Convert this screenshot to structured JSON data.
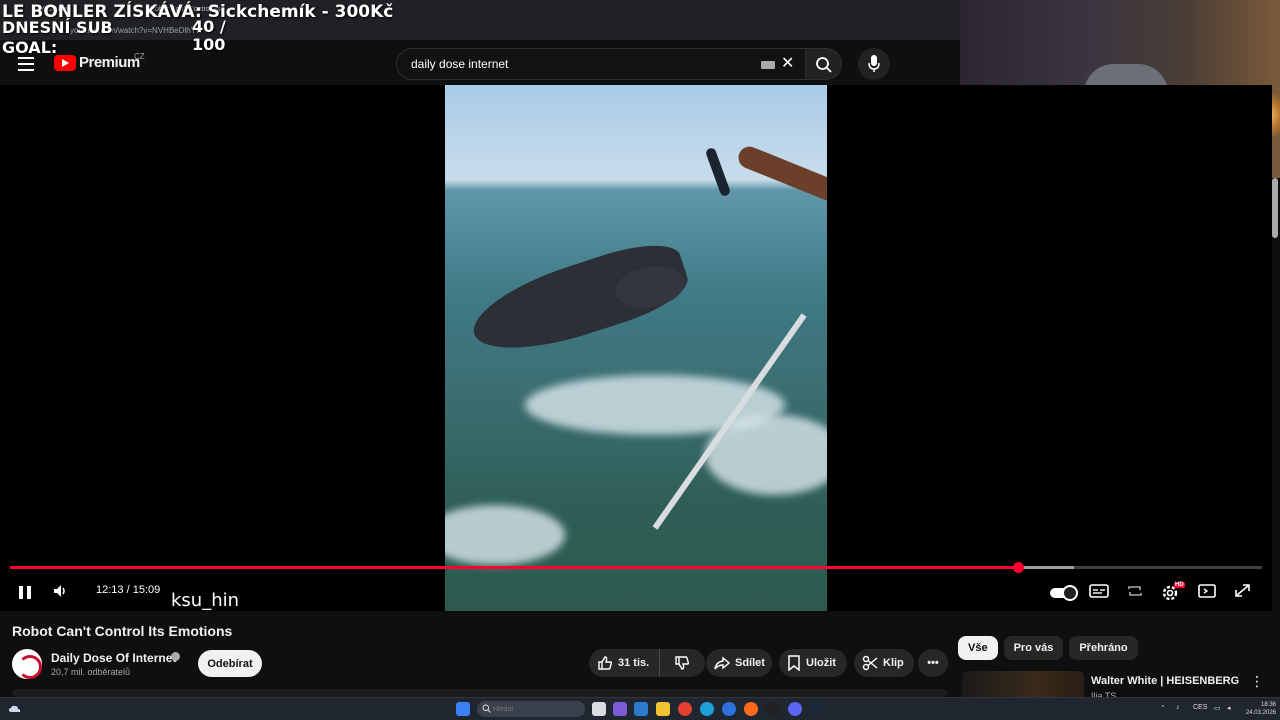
{
  "overlay": {
    "top_text": "LE BONLER ZÍSKÁVÁ: Sickchemík - 300Kč",
    "goal_label": "DNESNÍ SUB GOAL:",
    "goal_value": "40 / 100"
  },
  "browser": {
    "url": "youtube.com/watch?v=NVHBeDlhYw",
    "tabs": [
      "YouTube",
      "Robot Can't Control Its"
    ]
  },
  "header": {
    "logo_text": "Premium",
    "country_code": "CZ",
    "search_value": "daily dose internet"
  },
  "player": {
    "current_time": "12:13",
    "duration": "15:09",
    "time_separator": " / ",
    "progress_fraction": 0.805,
    "buffer_fraction": 0.85,
    "hd_label": "HD",
    "watermark": "ksu_hin"
  },
  "video": {
    "title": "Robot Can't Control Its Emotions",
    "channel_name": "Daily Dose Of Internet",
    "subscribers": "20,7 mil. odběratelů",
    "subscribe_label": "Odebírat",
    "like_count": "31 tis.",
    "share_label": "Sdílet",
    "save_label": "Uložit",
    "clip_label": "Klip"
  },
  "sidebar": {
    "chips": [
      "Vše",
      "Pro vás",
      "Přehráno"
    ],
    "recommendation": {
      "title": "Walter White | HEISENBERG",
      "channel": "Ilja TS"
    }
  },
  "taskbar": {
    "search_placeholder": "Hledat",
    "language": "CES",
    "time": "18:36",
    "date": "24.03.2026"
  },
  "colors": {
    "accent": "#ff0033",
    "background": "#0f0f0f",
    "pill": "#272727"
  }
}
